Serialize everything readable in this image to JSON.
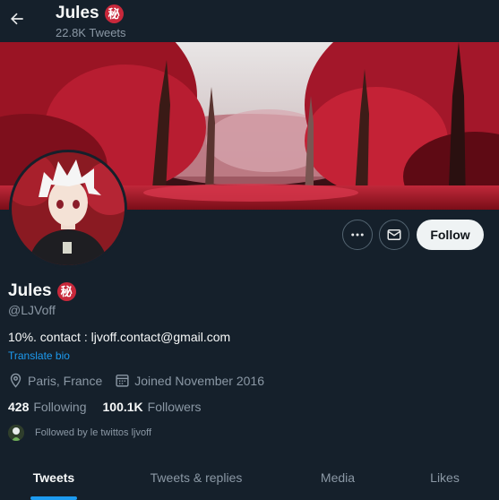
{
  "header": {
    "name": "Jules",
    "badge_char": "秘",
    "tweet_count": "22.8K Tweets"
  },
  "actions": {
    "follow_label": "Follow"
  },
  "profile": {
    "name": "Jules",
    "badge_char": "秘",
    "handle": "@LJVoff",
    "bio": "10%. contact : ljvoff.contact@gmail.com",
    "translate_label": "Translate bio",
    "location": "Paris, France",
    "joined": "Joined November 2016",
    "following_count": "428",
    "following_label": "Following",
    "followers_count": "100.1K",
    "followers_label": "Followers",
    "followed_by": "Followed by le twittos ljvoff"
  },
  "tabs": [
    {
      "label": "Tweets",
      "active": true
    },
    {
      "label": "Tweets & replies",
      "active": false
    },
    {
      "label": "Media",
      "active": false
    },
    {
      "label": "Likes",
      "active": false
    }
  ],
  "colors": {
    "background": "#15202b",
    "accent": "#1d9bf0",
    "badge": "#c8283b",
    "text_primary": "#f7f9f9",
    "text_secondary": "#8b98a5"
  },
  "icons": {
    "back": "arrow-left-icon",
    "more": "more-dots-icon",
    "mail": "mail-icon",
    "location": "location-pin-icon",
    "calendar": "calendar-icon"
  }
}
